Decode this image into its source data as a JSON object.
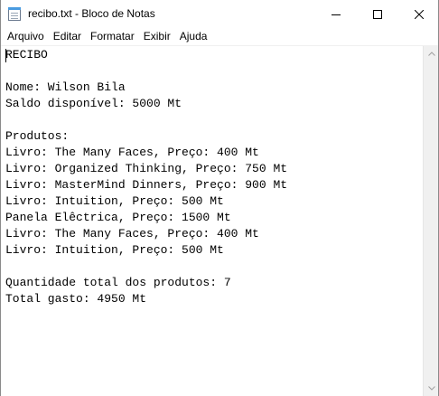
{
  "window": {
    "title": "recibo.txt - Bloco de Notas"
  },
  "menu": {
    "items": [
      "Arquivo",
      "Editar",
      "Formatar",
      "Exibir",
      "Ajuda"
    ]
  },
  "editor": {
    "lines": [
      "RECIBO",
      "",
      "Nome: Wilson Bila",
      "Saldo disponível: 5000 Mt",
      "",
      "Produtos:",
      "Livro: The Many Faces, Preço: 400 Mt",
      "Livro: Organized Thinking, Preço: 750 Mt",
      "Livro: MasterMind Dinners, Preço: 900 Mt",
      "Livro: Intuition, Preço: 500 Mt",
      "Panela Elêctrica, Preço: 1500 Mt",
      "Livro: The Many Faces, Preço: 400 Mt",
      "Livro: Intuition, Preço: 500 Mt",
      "",
      "Quantidade total dos produtos: 7",
      "Total gasto: 4950 Mt"
    ]
  },
  "icons": {
    "app": "notepad-icon",
    "minimize": "minimize-icon",
    "maximize": "maximize-icon",
    "close": "close-icon",
    "scroll_up": "chevron-up-icon",
    "scroll_down": "chevron-down-icon"
  }
}
